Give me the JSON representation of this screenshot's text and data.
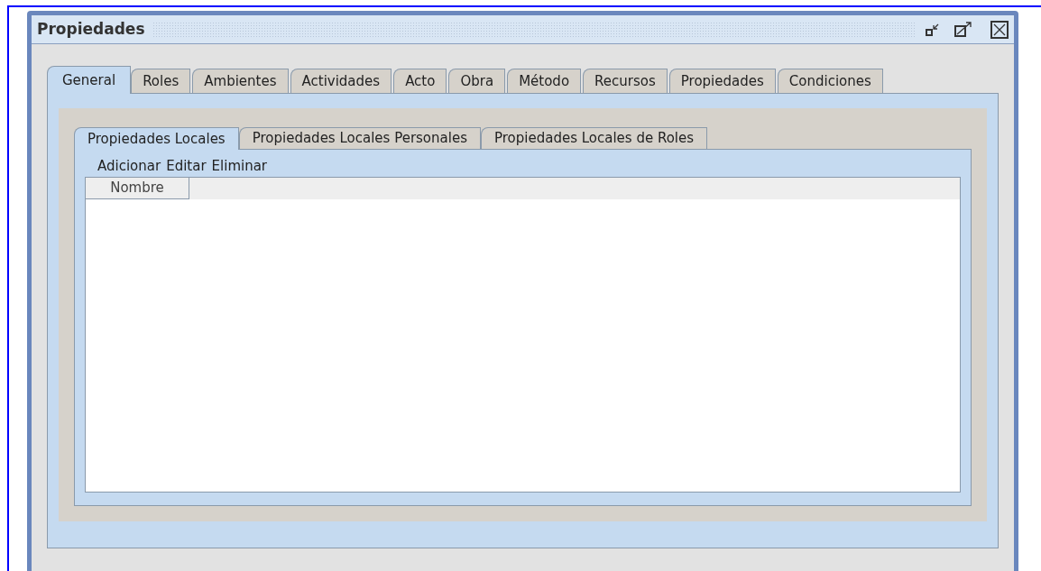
{
  "window": {
    "title": "Propiedades"
  },
  "tabs": [
    {
      "label": "General",
      "selected": true
    },
    {
      "label": "Roles",
      "selected": false
    },
    {
      "label": "Ambientes",
      "selected": false
    },
    {
      "label": "Actividades",
      "selected": false
    },
    {
      "label": "Acto",
      "selected": false
    },
    {
      "label": "Obra",
      "selected": false
    },
    {
      "label": "Método",
      "selected": false
    },
    {
      "label": "Recursos",
      "selected": false
    },
    {
      "label": "Propiedades",
      "selected": false
    },
    {
      "label": "Condiciones",
      "selected": false
    }
  ],
  "subtabs": [
    {
      "label": "Propiedades Locales",
      "selected": true
    },
    {
      "label": "Propiedades Locales Personales",
      "selected": false
    },
    {
      "label": "Propiedades Locales de Roles",
      "selected": false
    }
  ],
  "toolbar": [
    "Adicionar",
    "Editar",
    "Eliminar"
  ],
  "table": {
    "columns": [
      "Nombre"
    ]
  }
}
